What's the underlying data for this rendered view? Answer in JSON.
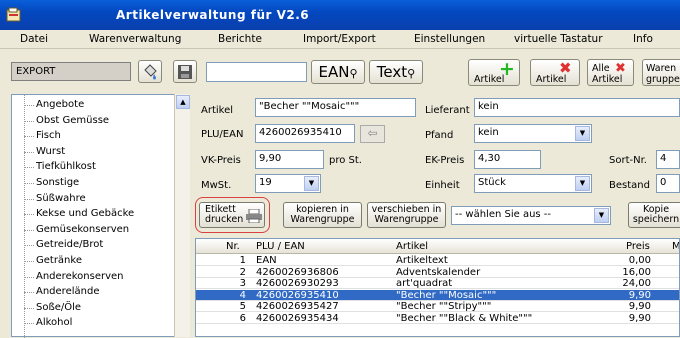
{
  "window": {
    "title": "Artikelverwaltung für V2.6"
  },
  "menu": [
    "Datei",
    "Warenverwaltung",
    "Berichte",
    "Import/Export",
    "Einstellungen",
    "virtuelle Tastatur",
    "Info"
  ],
  "toolbar": {
    "mode": "EXPORT",
    "search_value": "",
    "ean_label": "EAN",
    "text_label": "Text",
    "add_label": "Artikel",
    "delete_label": "Artikel",
    "delete_all_label_1": "Alle",
    "delete_all_label_2": "Artikel",
    "group_label_1": "Waren",
    "group_label_2": "gruppe"
  },
  "sidebar": {
    "items": [
      "Angebote",
      "Obst Gemüsse",
      "Fisch",
      "Wurst",
      "Tiefkühlkost",
      "Sonstige",
      "Süßwahre",
      "Kekse und Gebäcke",
      "Gemüsekonserven",
      "Getreide/Brot",
      "Getränke",
      "Anderekonserven",
      "Anderelände",
      "Soße/Öle",
      "Alkohol"
    ]
  },
  "form": {
    "artikel_label": "Artikel",
    "artikel_value": "\"Becher \"\"Mosaic\"\"\"",
    "lieferant_label": "Lieferant",
    "lieferant_value": "kein",
    "plu_label": "PLU/EAN",
    "plu_value": "4260026935410",
    "pfand_label": "Pfand",
    "pfand_value": "kein",
    "vk_label": "VK-Preis",
    "vk_value": "9,90",
    "vk_unit": "pro St.",
    "ek_label": "EK-Preis",
    "ek_value": "4,30",
    "sort_label": "Sort-Nr.",
    "sort_value": "4",
    "mwst_label": "MwSt.",
    "mwst_value": "19",
    "einheit_label": "Einheit",
    "einheit_value": "Stück",
    "bestand_label": "Bestand",
    "bestand_value": "0"
  },
  "actions": {
    "print_1": "Etikett",
    "print_2": "drucken",
    "copy_1": "kopieren in",
    "copy_2": "Warengruppe",
    "move_1": "verschieben in",
    "move_2": "Warengruppe",
    "group_select": "-- wählen Sie aus --",
    "kopie_1": "Kopie",
    "kopie_2": "speichern"
  },
  "table": {
    "headers": [
      "Nr.",
      "PLU / EAN",
      "Artikel",
      "Preis",
      "M"
    ],
    "rows": [
      {
        "nr": "1",
        "plu": "EAN",
        "artikel": "Artikeltext",
        "preis": "0,00"
      },
      {
        "nr": "2",
        "plu": "4260026936806",
        "artikel": "Adventskalender",
        "preis": "16,00"
      },
      {
        "nr": "3",
        "plu": "4260026930293",
        "artikel": "art'quadrat",
        "preis": "24,00"
      },
      {
        "nr": "4",
        "plu": "4260026935410",
        "artikel": "\"Becher \"\"Mosaic\"\"\"",
        "preis": "9,90"
      },
      {
        "nr": "5",
        "plu": "4260026935427",
        "artikel": "\"Becher \"\"Stripy\"\"\"",
        "preis": "9,90"
      },
      {
        "nr": "6",
        "plu": "4260026935434",
        "artikel": "\"Becher \"\"Black & White\"\"\"",
        "preis": "9,90"
      }
    ],
    "selected_row": 3
  },
  "colors": {
    "titlebar": "#0a4fc6",
    "selection": "#316ac5",
    "add_plus": "#22b822",
    "delete_x": "#e03030"
  }
}
